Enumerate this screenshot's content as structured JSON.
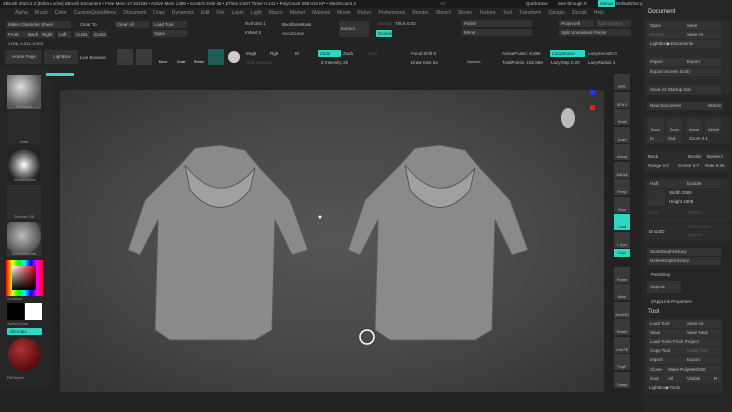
{
  "title": "ZBrush 2023.2.2 [Erika Lochs]  ZBrush Document    • Free Mem 17.331GB • Active Mem 1386 • Scratch Disk 45 • ZTime 3.507 Timer 0.141 • PolyCount 298.012 KP • MeshCount 3",
  "topright": {
    "ac": "AC",
    "quicksave": "QuickSave",
    "seethrough": "See-through 0",
    "menus": "Menus",
    "script": "DefaultZScript"
  },
  "menu": [
    "Alpha",
    "Brush",
    "Color",
    "CustomQuickMenu",
    "Document",
    "Draw",
    "Dynamics",
    "Edit",
    "File",
    "Layer",
    "Light",
    "Macro",
    "Marker",
    "Material",
    "Movie",
    "Picker",
    "Preferences",
    "Render",
    "Stencil",
    "Stroke",
    "Texture",
    "Tool",
    "Transform",
    "Zplugin",
    "Zscript",
    "Help"
  ],
  "palette": {
    "make_sheet": "Make Character Sheet",
    "clear_to": "Clear To",
    "front": "Front",
    "back": "Back",
    "right": "Right",
    "left": "Left",
    "cust1": "Cust1",
    "cust2": "Cust2",
    "clear_all": "Clear All",
    "load_tool": "Load Tool",
    "open": "Open",
    "roll_dist": "Roll Dist 1",
    "imbed": "Imbed 0",
    "backface": "BackfaceMask",
    "accucurve": "AccuCurve",
    "extract": "Extract",
    "accept": "Accept",
    "thick": "Thick 0.02",
    "double": "Double",
    "polish": "Polish",
    "mirror": "Mirror",
    "projectall": "ProjectAll",
    "split_hidden": "Split Hidden",
    "split_unmasked": "Split Unmasked Points",
    "coords": "1.006,-0.313,-0.003"
  },
  "toolbar": {
    "home": "Home Page",
    "lightbox": "LightBox",
    "live_boolean": "Live Boolean",
    "edit": "Edit",
    "draw": "Draw",
    "move": "Move",
    "scale": "Scale",
    "rotate": "Rotate",
    "mrgb": "Mrgb",
    "rgb": "Rgb",
    "m": "M",
    "rgb_intensity": "Rgb Intensity",
    "zadd": "Zadd",
    "zsub": "Zsub",
    "zcut": "Zcut",
    "z_intensity": "Z Intensity 25",
    "focal_shift": "Focal Shift 0",
    "draw_size": "Draw Size 64",
    "dynamic": "Dynamic",
    "active_points": "ActivePoints: 8,066",
    "total_points": "TotalPoints: 152,968",
    "lazymouse": "LazyMouse",
    "lazysmooth": "LazySmooth 0",
    "lazystep": "LazyStep 0.25",
    "lazyradius": "LazyRadius 1"
  },
  "left": {
    "brush": "Standard",
    "stroke": "Dots",
    "alpha": "~BrushAlpha",
    "texture": "Texture Off",
    "material": "BasicMaterial",
    "gradient": "Gradient",
    "switch": "SwitchColor",
    "alternate": "Alternate",
    "fill": "FillObject"
  },
  "right_shelf": [
    "BPR",
    "SPix 3",
    "Scroll",
    "Zoom",
    "Actual",
    "AAHalf",
    "Persp",
    "Floor",
    "Local",
    "L.Sym",
    "Gxyz",
    "Frame",
    "Move",
    "Zoom3D",
    "Rotate",
    "Line Fill",
    "PolyF",
    "Transp"
  ],
  "document": {
    "title": "Document",
    "open": "Open",
    "save": "Save",
    "revert": "Revert",
    "save_as": "Save As",
    "lightbox_docs": "Lightbox▶Documents",
    "import": "Import",
    "export": "Export",
    "export_grab": "Export Screen Grab",
    "startup": "Save As Startup Doc",
    "new_doc": "New Document",
    "wsize": "WSize",
    "scroll": "Scroll",
    "zoom_btn": "Zoom",
    "actual": "Actual",
    "aahalf": "AAHalf",
    "in": "In",
    "out": "Out",
    "zoom": "Zoom 0.1",
    "back": "Back",
    "border": "Border",
    "border2": "Border2",
    "range": "Range 0.0",
    "center": "Center 0.7",
    "rate": "Rate 0.25",
    "half": "Half",
    "double": "Double",
    "pro": "Pro",
    "width": "Width 3388",
    "height": "Height 1908",
    "crop": "Crop",
    "resize": "Resize",
    "drop3d": "Drop3D",
    "subpixel": "Sub Pixel Size",
    "optimize": "Optimize",
    "store_depth": "StoreDepthHistory",
    "delete_depth": "DeleteDepthHistory",
    "paintstop": "PaintStop",
    "zapplink": "ZAppLink",
    "zapplink_props": "ZAppLink Properties"
  },
  "tool": {
    "title": "Tool",
    "load_tool": "Load Tool",
    "save_as": "Save As",
    "save": "Save",
    "save_next": "Save Next",
    "load_from_project": "Load Tools From Project",
    "copy_tool": "Copy Tool",
    "paste_tool": "Paste Tool",
    "import": "Import",
    "export": "Export",
    "clone": "Clone",
    "make_polymesh": "Make PolyMesh3D",
    "goz": "GoZ",
    "all": "All",
    "visible": "Visible",
    "r": "R",
    "lightbox_tools": "Lightbox▶Tools"
  },
  "colors": {
    "accent": "#2fd6c4",
    "bg": "#232323"
  }
}
